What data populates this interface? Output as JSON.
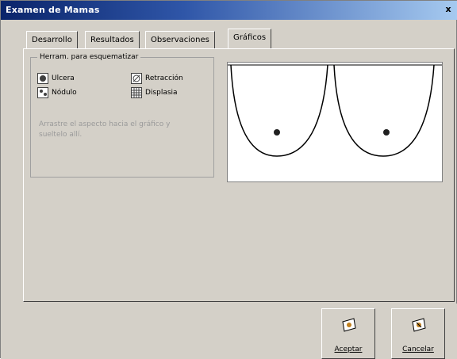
{
  "window": {
    "title": "Examen de Mamas",
    "close_glyph": "x"
  },
  "tabs": [
    {
      "label": "Desarrollo",
      "active": false
    },
    {
      "label": "Resultados",
      "active": false
    },
    {
      "label": "Observaciones",
      "active": false
    },
    {
      "label": "Gráficos",
      "active": true
    }
  ],
  "tools": {
    "legend": "Herram. para esquematizar",
    "items": [
      {
        "label": "Ulcera",
        "icon": "ulcer-icon"
      },
      {
        "label": "Retracción",
        "icon": "retraction-icon"
      },
      {
        "label": "Nódulo",
        "icon": "nodule-icon"
      },
      {
        "label": "Displasia",
        "icon": "dysplasia-icon"
      }
    ],
    "hint": "Arrastre el aspecto hacia el gráfico y sueltelo allí."
  },
  "buttons": {
    "accept": "Aceptar",
    "cancel": "Cancelar"
  },
  "colors": {
    "title_bar_start": "#0a246a",
    "title_bar_end": "#a6caf0",
    "face": "#d4d0c8"
  }
}
